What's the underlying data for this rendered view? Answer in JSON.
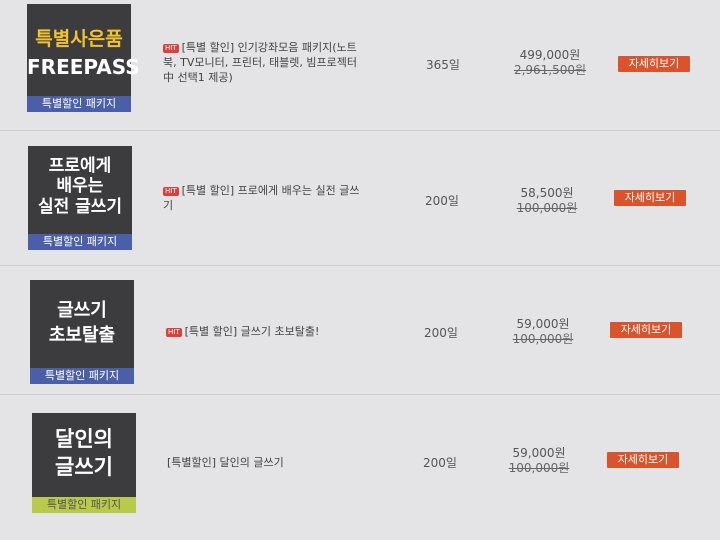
{
  "products": [
    {
      "thumb_title": "특별사은품\nFREEPASS",
      "thumb_band": "특별할인 패키지",
      "title_prefix": "[특별 할인]",
      "title_lines": [
        "[특별 할인] 인기강좌모음 패키지(노트",
        "북, TV모니터, 프린터, 태블렛, 빔프로젝터",
        "中 선택1 제공)"
      ],
      "hit": "HIT",
      "period": "365일",
      "price": "499,000원",
      "original_price": "2,961,500원",
      "button": "자세히보기"
    },
    {
      "thumb_title": "프로에게\n배우는\n실전 글쓰기",
      "thumb_band": "특별할인 패키지",
      "title_lines": [
        "[특별 할인] 프로에게 배우는 실전 글쓰",
        "기"
      ],
      "hit": "HIT",
      "period": "200일",
      "price": "58,500원",
      "original_price": "100,000원",
      "button": "자세히보기"
    },
    {
      "thumb_title": "글쓰기\n초보탈출",
      "thumb_band": "특별할인 패키지",
      "title_lines": [
        "[특별 할인] 글쓰기 초보탈출!"
      ],
      "hit": "HIT",
      "period": "200일",
      "price": "59,000원",
      "original_price": "100,000원",
      "button": "자세히보기"
    },
    {
      "thumb_title": "달인의\n글쓰기",
      "thumb_band": "특별할인 패키지",
      "title_lines": [
        "[특별할인] 달인의 글쓰기"
      ],
      "hit": "",
      "period": "200일",
      "price": "59,000원",
      "original_price": "100,000원",
      "button": "자세히보기"
    }
  ],
  "colors": {
    "background": "#e4e4e6",
    "thumb_bg": "#3c3c3e",
    "accent_yellow": "#f2c12e",
    "band_blue": "#4a5fa8",
    "band_lime": "#b9c94a",
    "button": "#d9542c",
    "hit_badge": "#d9413a"
  }
}
